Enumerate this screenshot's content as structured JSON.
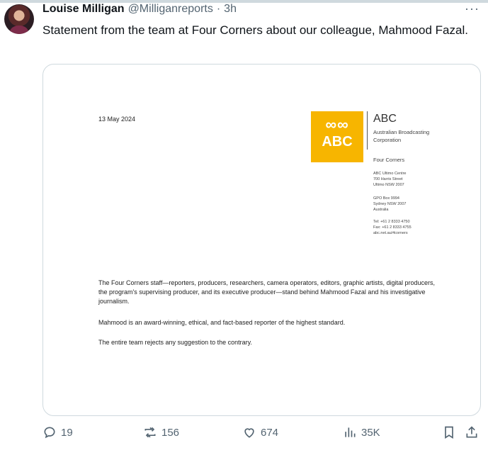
{
  "tweet": {
    "author_name": "Louise Milligan",
    "handle": "@Milliganreports",
    "separator": "·",
    "time": "3h",
    "more": "···",
    "text": "Statement from the team at Four Corners about our colleague, Mahmood Fazal."
  },
  "document": {
    "date": "13 May 2024",
    "logo_text": "ABC",
    "org_short": "ABC",
    "org_full": "Australian Broadcasting Corporation",
    "program": "Four Corners",
    "address_block_1": "ABC Ultimo Centre\n700 Harris Street\nUltimo NSW 2007",
    "address_block_2": "GPO Box 9994\nSydney NSW 2007\nAustralia",
    "address_block_3": "Tel: +61 2 8333 4750\nFax: +61 2 8333 4755\nabc.net.au/4corners",
    "paragraph_1": "The Four Corners staff—reporters, producers, researchers, camera operators, editors, graphic artists, digital producers, the program's supervising producer, and its executive producer—stand behind Mahmood Fazal and his investigative journalism.",
    "paragraph_2": "Mahmood is an award-winning, ethical, and fact-based reporter of the highest standard.",
    "paragraph_3": "The entire team rejects any suggestion to the contrary."
  },
  "actions": {
    "replies": "19",
    "reposts": "156",
    "likes": "674",
    "views": "35K"
  },
  "icons": {
    "reply": "speech-bubble-icon",
    "repost": "repost-icon",
    "like": "heart-icon",
    "views": "bar-chart-icon",
    "bookmark": "bookmark-icon",
    "share": "share-icon"
  }
}
